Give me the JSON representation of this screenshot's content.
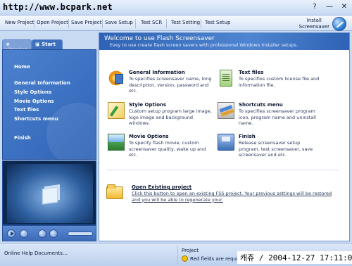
{
  "watermark": "http://www.bcpark.net",
  "window_buttons": [
    "?",
    "—",
    "✕"
  ],
  "toolbar": {
    "items": [
      "New Project",
      "Open Project",
      "Save Project",
      "Save Setup",
      "Test SCR",
      "Test Setting",
      "Test Setup"
    ],
    "install_line1": "Install",
    "install_line2": "Screensaver"
  },
  "sidebar": {
    "tabs": {
      "librarian": "Librarian",
      "start": "Start"
    },
    "nav": [
      "Home",
      "General Information",
      "Style Options",
      "Movie Options",
      "Text files",
      "Shortcuts menu",
      "Finish"
    ]
  },
  "main": {
    "title": "Welcome to use Flash Screensaver",
    "subtitle": "Easy to use create flash screen savers with professional Windows Installer setups.",
    "items": [
      {
        "title": "General Information",
        "desc": "To specifies screensaver name, long description, version, password and etc.",
        "icon": "gear-settings-icon"
      },
      {
        "title": "Text files",
        "desc": "To specifies custom license file and information file.",
        "icon": "text-file-icon"
      },
      {
        "title": "Style Options",
        "desc": "Custom setup program large image, logo image and background windows.",
        "icon": "style-brush-icon"
      },
      {
        "title": "Shortcuts menu",
        "desc": "To specifies screensaver program icon, program name and uninstall name.",
        "icon": "shortcut-icon"
      },
      {
        "title": "Movie Options",
        "desc": "To specify flash movie, custom screensaver quality, wake up and etc.",
        "icon": "movie-image-icon"
      },
      {
        "title": "Finish",
        "desc": "Release screensaver setup program, test screensaver, save screensaver and etc.",
        "icon": "floppy-disk-icon"
      }
    ],
    "open": {
      "title": "Open Existing project",
      "desc": "Click this button to open an existing FSS project. Your previous settings will be restored and you will be able to regenerate your.",
      "icon": "open-folder-icon"
    }
  },
  "statusbar": {
    "left": "Online Help Documents...",
    "project": "Project",
    "warning": "Red fields are require",
    "photo_stamp": "캐쥬 / 2004-12-27 17:11:01"
  }
}
